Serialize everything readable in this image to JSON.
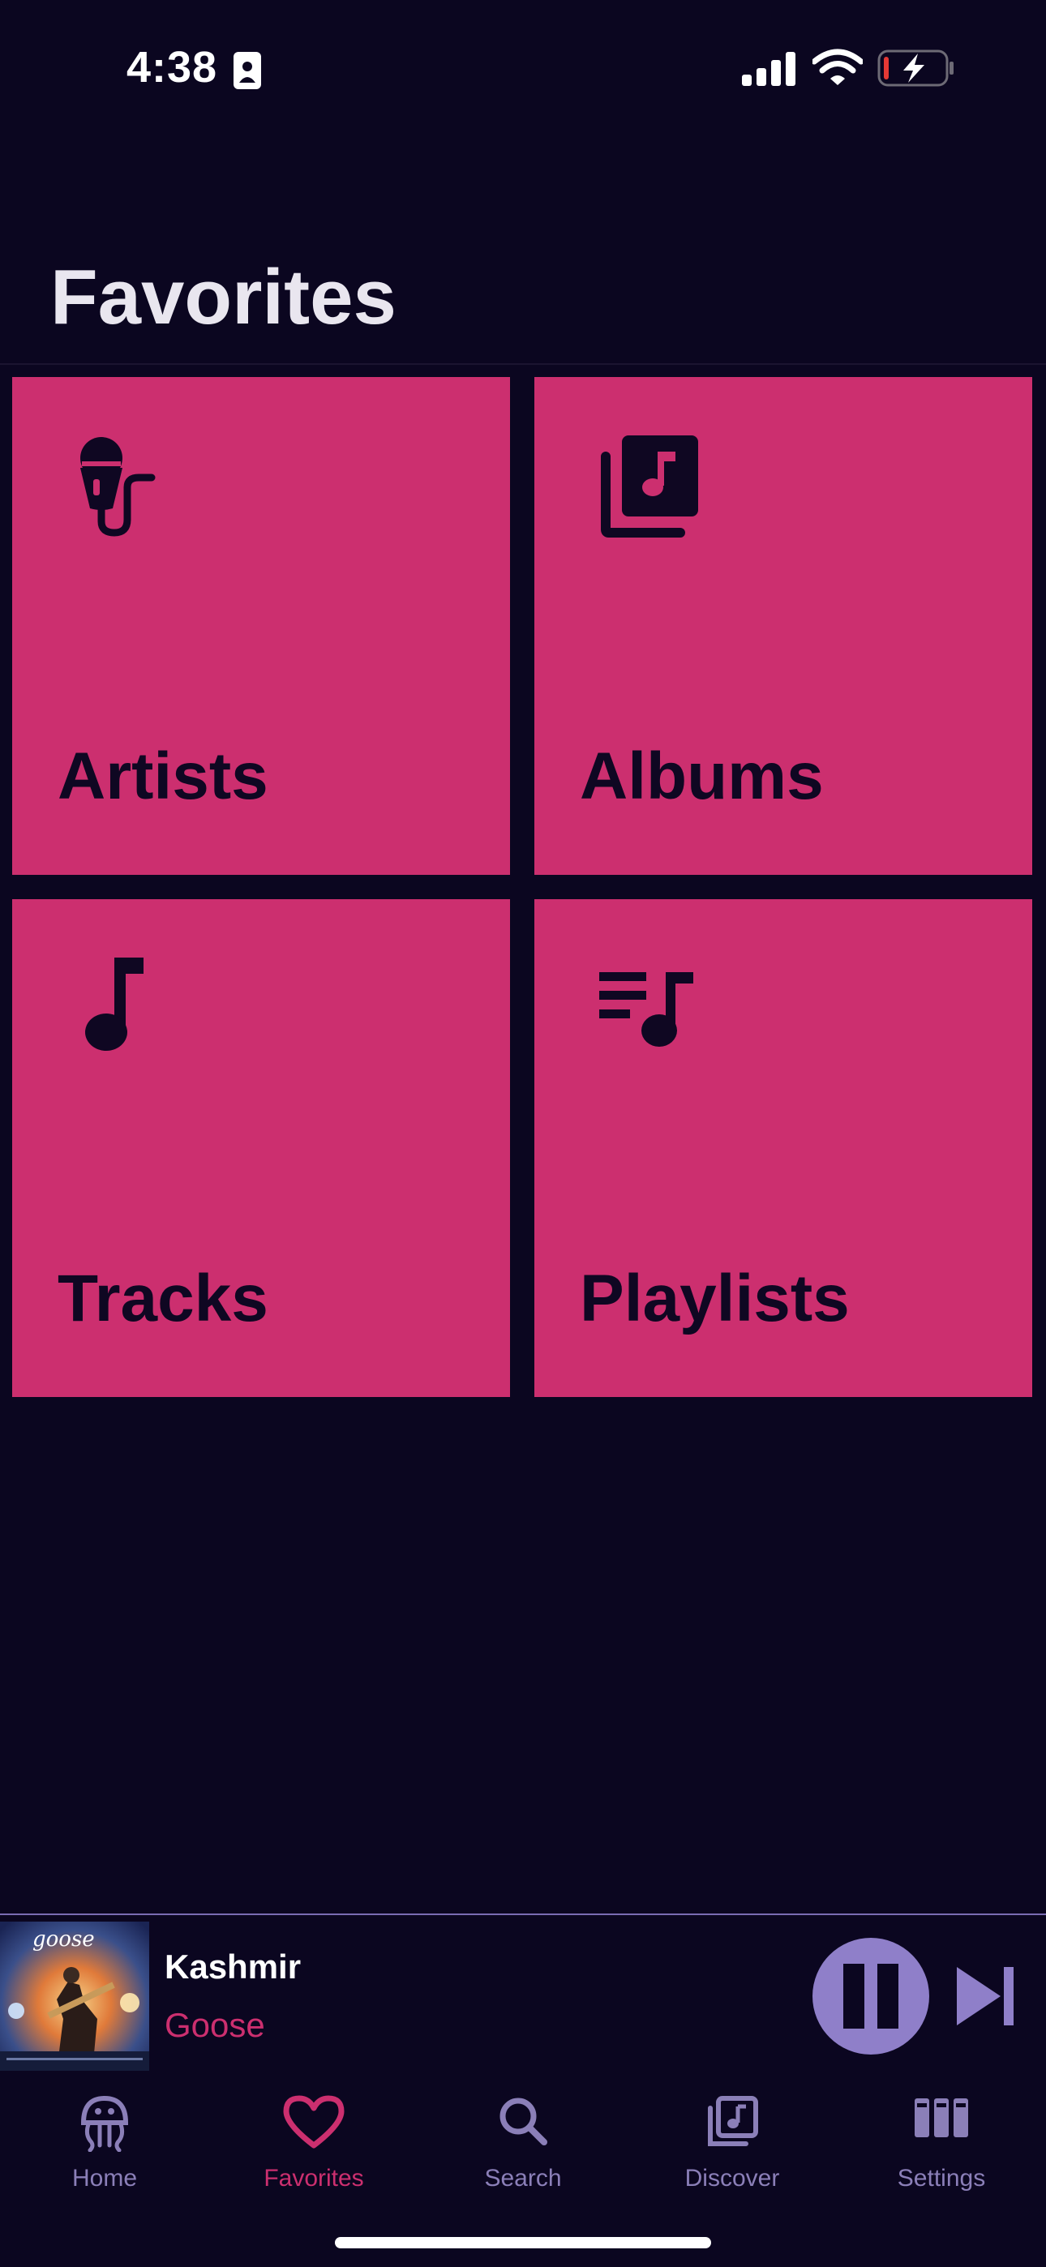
{
  "status_bar": {
    "time": "4:38"
  },
  "header": {
    "title": "Favorites"
  },
  "tiles": [
    {
      "label": "Artists",
      "icon": "microphone-icon"
    },
    {
      "label": "Albums",
      "icon": "album-library-icon"
    },
    {
      "label": "Tracks",
      "icon": "music-note-icon"
    },
    {
      "label": "Playlists",
      "icon": "playlist-icon"
    }
  ],
  "now_playing": {
    "title": "Kashmir",
    "artist": "Goose",
    "album_art_text": "goose"
  },
  "tabs": [
    {
      "label": "Home",
      "icon": "jellyfish-icon",
      "active": false
    },
    {
      "label": "Favorites",
      "icon": "heart-icon",
      "active": true
    },
    {
      "label": "Search",
      "icon": "search-icon",
      "active": false
    },
    {
      "label": "Discover",
      "icon": "album-library-icon",
      "active": false
    },
    {
      "label": "Settings",
      "icon": "library-columns-icon",
      "active": false
    }
  ],
  "colors": {
    "background": "#0b0620",
    "accent": "#cc2f6f",
    "tile_text": "#0f0722",
    "muted": "#8b7fb8",
    "player_button": "#8f7fc9"
  }
}
